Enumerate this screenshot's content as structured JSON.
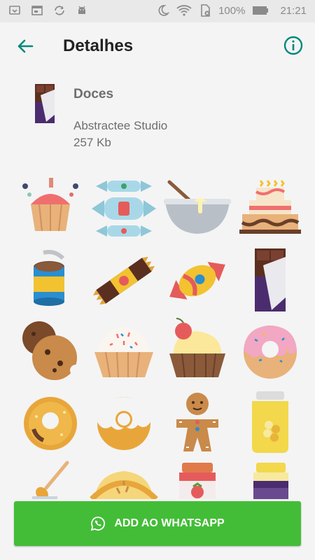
{
  "status_bar": {
    "battery": "100%",
    "time": "21:21",
    "icons": [
      "notification-icon",
      "browser-icon",
      "sync-icon",
      "android-icon",
      "moon-icon",
      "wifi-icon",
      "sim-icon",
      "battery-icon"
    ]
  },
  "app_bar": {
    "title": "Detalhes",
    "back_icon": "arrow-left-icon",
    "info_icon": "info-icon",
    "accent_color": "#00897b"
  },
  "sticker_pack": {
    "name": "Doces",
    "author": "Abstractee Studio",
    "size": "257 Kb",
    "icon": "chocolate-bar-icon"
  },
  "stickers": [
    {
      "name": "cupcake-sprinkles-sticker"
    },
    {
      "name": "wrapped-candies-sticker"
    },
    {
      "name": "mixing-bowl-sticker"
    },
    {
      "name": "layer-cake-sticker"
    },
    {
      "name": "condensed-milk-can-sticker"
    },
    {
      "name": "candy-bar-sticker"
    },
    {
      "name": "wrapped-candy-sticker"
    },
    {
      "name": "chocolate-bar-sticker"
    },
    {
      "name": "cookies-sticker"
    },
    {
      "name": "cream-cupcake-sticker"
    },
    {
      "name": "cherry-cupcake-sticker"
    },
    {
      "name": "pink-donut-sticker"
    },
    {
      "name": "orange-donut-sticker"
    },
    {
      "name": "glazed-donut-sticker"
    },
    {
      "name": "gingerbread-man-sticker"
    },
    {
      "name": "honey-jar-sticker"
    },
    {
      "name": "honey-dipper-sticker"
    },
    {
      "name": "pie-sticker"
    },
    {
      "name": "strawberry-jam-sticker"
    },
    {
      "name": "grape-jam-sticker"
    }
  ],
  "cta": {
    "label": "ADD AO WHATSAPP",
    "icon": "whatsapp-icon",
    "color": "#43bd37"
  }
}
